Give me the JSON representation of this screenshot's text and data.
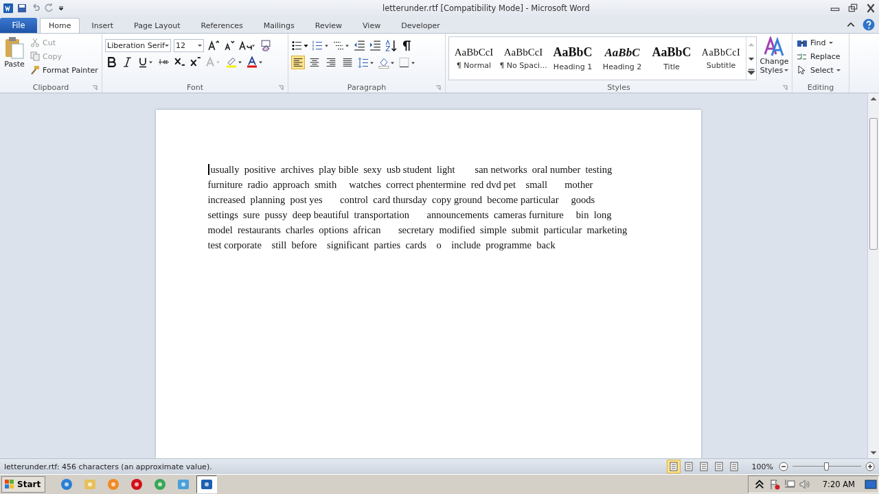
{
  "window": {
    "title": "letterunder.rtf [Compatibility Mode]  -  Microsoft Word"
  },
  "tabs": [
    {
      "label": "File",
      "kind": "file",
      "selected": false
    },
    {
      "label": "Home",
      "kind": "tab",
      "selected": true
    },
    {
      "label": "Insert",
      "kind": "tab",
      "selected": false
    },
    {
      "label": "Page Layout",
      "kind": "tab",
      "selected": false
    },
    {
      "label": "References",
      "kind": "tab",
      "selected": false
    },
    {
      "label": "Mailings",
      "kind": "tab",
      "selected": false
    },
    {
      "label": "Review",
      "kind": "tab",
      "selected": false
    },
    {
      "label": "View",
      "kind": "tab",
      "selected": false
    },
    {
      "label": "Developer",
      "kind": "tab",
      "selected": false
    }
  ],
  "clipboard": {
    "label": "Clipboard",
    "paste": "Paste",
    "items": [
      {
        "label": "Cut",
        "kind": "cut",
        "disabled": true
      },
      {
        "label": "Copy",
        "kind": "copy",
        "disabled": true
      },
      {
        "label": "Format Painter",
        "kind": "painter",
        "disabled": false
      }
    ]
  },
  "font": {
    "label": "Font",
    "font_name": "Liberation Serif",
    "font_size": "12"
  },
  "paragraph": {
    "label": "Paragraph",
    "alignments": [
      {
        "selected": true
      },
      {
        "selected": false
      },
      {
        "selected": false
      },
      {
        "selected": false
      }
    ]
  },
  "styles": {
    "label": "Styles",
    "items": [
      {
        "preview": "AaBbCcI",
        "label": "¶ Normal",
        "kind": "normal"
      },
      {
        "preview": "AaBbCcI",
        "label": "¶ No Spaci...",
        "kind": "nospacing"
      },
      {
        "preview": "AaBbC",
        "label": "Heading 1",
        "kind": "heading1"
      },
      {
        "preview": "AaBbC",
        "label": "Heading 2",
        "kind": "heading2"
      },
      {
        "preview": "AaBbC",
        "label": "Title",
        "kind": "title"
      },
      {
        "preview": "AaBbCcI",
        "label": "Subtitle",
        "kind": "subtitle"
      }
    ],
    "change_styles": [
      "Change",
      "Styles"
    ]
  },
  "editing": {
    "label": "Editing",
    "items": [
      {
        "label": "Find",
        "kind": "find"
      },
      {
        "label": "Replace",
        "kind": "replace"
      },
      {
        "label": "Select",
        "kind": "select"
      }
    ]
  },
  "document": {
    "lines": [
      "usually  positive  archives  play bible  sexy  usb student  light        san networks  oral number  testing",
      "furniture  radio  approach  smith     watches  correct phentermine  red dvd pet    small       mother",
      "increased  planning  post yes       control  card thursday  copy ground  become particular     goods",
      "settings  sure  pussy  deep beautiful  transportation       announcements  cameras furniture     bin  long",
      "model  restaurants  charles  options  african       secretary  modified  simple  submit  particular  marketing",
      "test corporate    still  before    significant  parties  cards    o    include  programme  back"
    ]
  },
  "status_bar": {
    "text": "letterunder.rtf: 456 characters (an approximate value).",
    "views": [
      {
        "selected": true
      },
      {
        "selected": false
      },
      {
        "selected": false
      },
      {
        "selected": false
      },
      {
        "selected": false
      }
    ],
    "zoom": "100%",
    "zoom_slider": {
      "level": 0.5
    }
  },
  "taskbar": {
    "start": "Start",
    "apps": [
      {
        "kind": "ie",
        "selected": false
      },
      {
        "kind": "folder",
        "selected": false
      },
      {
        "kind": "media",
        "selected": false
      },
      {
        "kind": "opera",
        "selected": false
      },
      {
        "kind": "chrome",
        "selected": false
      },
      {
        "kind": "screen",
        "selected": false
      },
      {
        "kind": "word",
        "selected": true
      }
    ],
    "clock": "7:20 AM"
  }
}
